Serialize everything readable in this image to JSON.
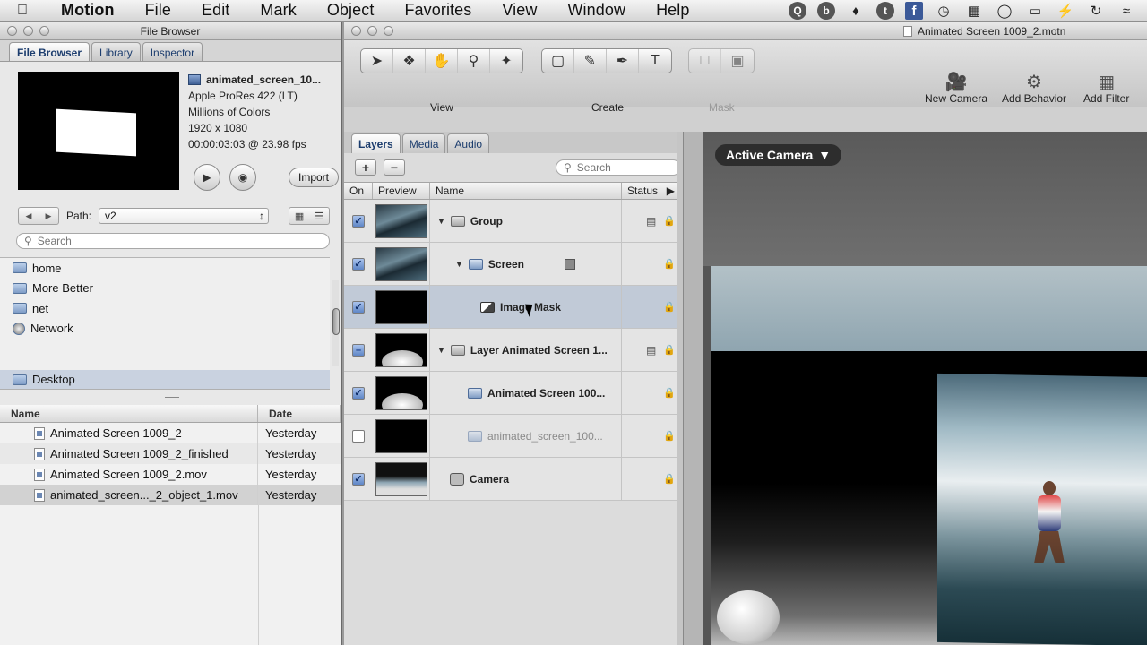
{
  "menubar": {
    "app": "Motion",
    "items": [
      "File",
      "Edit",
      "Mark",
      "Object",
      "Favorites",
      "View",
      "Window",
      "Help"
    ]
  },
  "file_browser": {
    "window_title": "File Browser",
    "tabs": [
      "File Browser",
      "Library",
      "Inspector"
    ],
    "preview": {
      "file_name": "animated_screen_10...",
      "codec": "Apple ProRes 422 (LT)",
      "colors": "Millions of Colors",
      "dimensions": "1920 x 1080",
      "timecode": "00:00:03:03 @ 23.98 fps",
      "import_label": "Import"
    },
    "path_label": "Path:",
    "path_value": "v2",
    "search_placeholder": "Search",
    "places": [
      "home",
      "More Better",
      "net",
      "Network"
    ],
    "selected_place": "Desktop",
    "columns": [
      "Name",
      "Date"
    ],
    "files": [
      {
        "name": "Animated Screen 1009_2",
        "date": "Yesterday"
      },
      {
        "name": "Animated Screen 1009_2_finished",
        "date": "Yesterday"
      },
      {
        "name": "Animated Screen 1009_2.mov",
        "date": "Yesterday"
      },
      {
        "name": "animated_screen..._2_object_1.mov",
        "date": "Yesterday"
      }
    ]
  },
  "project": {
    "window_title": "Animated Screen 1009_2.motn",
    "toolbar_groups": [
      "View",
      "Create",
      "Mask"
    ],
    "toolbar_right": [
      "New Camera",
      "Add Behavior",
      "Add Filter"
    ]
  },
  "layers_panel": {
    "tabs": [
      "Layers",
      "Media",
      "Audio"
    ],
    "search_placeholder": "Search",
    "columns": [
      "On",
      "Preview",
      "Name",
      "Status"
    ],
    "rows": [
      {
        "name": "Group",
        "checked": "checked",
        "indent": 0,
        "expanded": true
      },
      {
        "name": "Screen",
        "checked": "checked",
        "indent": 1,
        "expanded": true
      },
      {
        "name": "Image Mask",
        "checked": "checked",
        "indent": 2,
        "expanded": false,
        "selected": true
      },
      {
        "name": "Layer Animated Screen 1...",
        "checked": "mixed",
        "indent": 0,
        "expanded": true
      },
      {
        "name": "Animated Screen 100...",
        "checked": "checked",
        "indent": 1,
        "expanded": false
      },
      {
        "name": "animated_screen_100...",
        "checked": "unchecked",
        "indent": 1,
        "expanded": false,
        "disabled": true
      },
      {
        "name": "Camera",
        "checked": "checked",
        "indent": 0,
        "expanded": false
      }
    ]
  },
  "canvas": {
    "camera_menu": "Active Camera"
  }
}
